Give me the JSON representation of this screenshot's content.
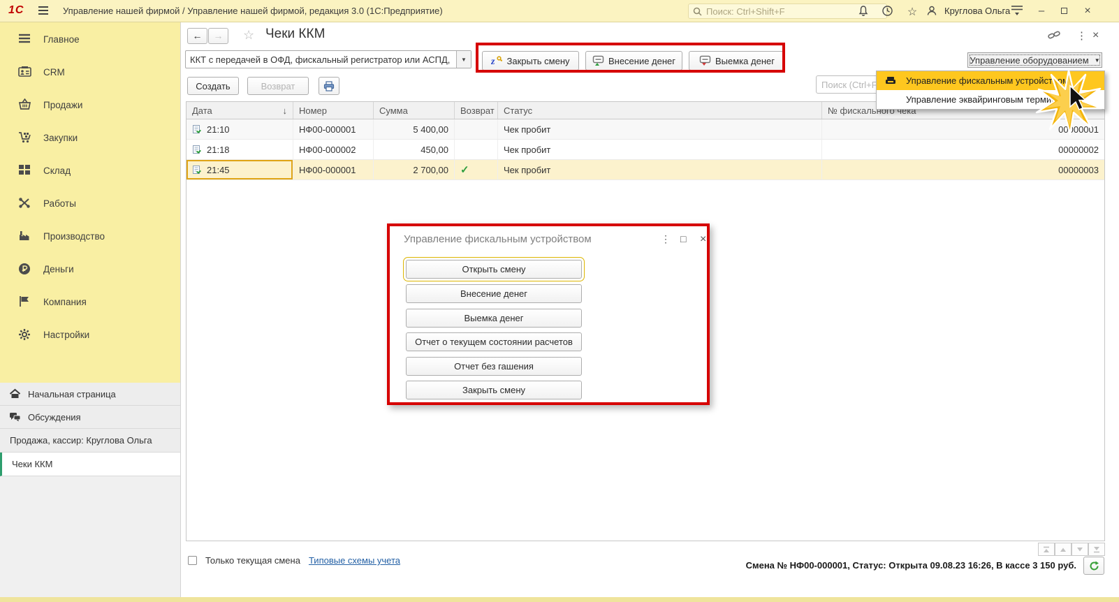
{
  "window": {
    "logo": "1С",
    "title": "Управление нашей фирмой / Управление нашей фирмой, редакция 3.0  (1С:Предприятие)",
    "search_placeholder": "Поиск: Ctrl+Shift+F",
    "user": "Круглова Ольга"
  },
  "sidebar": {
    "items": [
      {
        "label": "Главное"
      },
      {
        "label": "CRM"
      },
      {
        "label": "Продажи"
      },
      {
        "label": "Закупки"
      },
      {
        "label": "Склад"
      },
      {
        "label": "Работы"
      },
      {
        "label": "Производство"
      },
      {
        "label": "Деньги"
      },
      {
        "label": "Компания"
      },
      {
        "label": "Настройки"
      }
    ]
  },
  "tabs": {
    "home": "Начальная страница",
    "discussions": "Обсуждения",
    "session": "Продажа, кассир: Круглова Ольга",
    "active": "Чеки ККМ"
  },
  "page": {
    "title": "Чеки ККМ",
    "device_combo": "ККТ с передачей в ОФД, фискальный регистратор или АСПД,",
    "close_shift": "Закрыть смену",
    "deposit": "Внесение денег",
    "withdraw": "Выемка денег",
    "create": "Создать",
    "refund": "Возврат",
    "equipment": "Управление оборудованием",
    "list_search_placeholder": "Поиск (Ctrl+F)"
  },
  "menu": {
    "items": [
      {
        "label": "Управление фискальным устройством"
      },
      {
        "label": "Управление эквайринговым терминалом"
      }
    ]
  },
  "table": {
    "headers": {
      "date": "Дата",
      "number": "Номер",
      "sum": "Сумма",
      "refund": "Возврат",
      "status": "Статус",
      "fiscal": "№ фискального чека"
    },
    "rows": [
      {
        "time": "21:10",
        "number": "НФ00-000001",
        "sum": "5 400,00",
        "refund": false,
        "status": "Чек пробит",
        "fiscal": "00000001",
        "selected": false
      },
      {
        "time": "21:18",
        "number": "НФ00-000002",
        "sum": "450,00",
        "refund": false,
        "status": "Чек пробит",
        "fiscal": "00000002",
        "selected": false
      },
      {
        "time": "21:45",
        "number": "НФ00-000001",
        "sum": "2 700,00",
        "refund": true,
        "status": "Чек пробит",
        "fiscal": "00000003",
        "selected": true
      }
    ]
  },
  "dialog": {
    "title": "Управление фискальным устройством",
    "buttons": [
      "Открыть смену",
      "Внесение денег",
      "Выемка денег",
      "Отчет о текущем состоянии расчетов",
      "Отчет без гашения",
      "Закрыть смену"
    ]
  },
  "footer": {
    "only_current_shift": "Только текущая смена",
    "schemes_link": "Типовые схемы учета",
    "status_line": "Смена № НФ00-000001, Статус: Открыта 09.08.23 16:26, В кассе 3 150 руб."
  },
  "colors": {
    "annotation_red": "#d60000",
    "menu_highlight": "#fec71f",
    "selected_row": "#fcf2cd",
    "sidebar_yellow": "#f9efa3",
    "titlebar_yellow": "#fbf3c1",
    "link_blue": "#2360a5",
    "check_green": "#2e9e3e"
  }
}
